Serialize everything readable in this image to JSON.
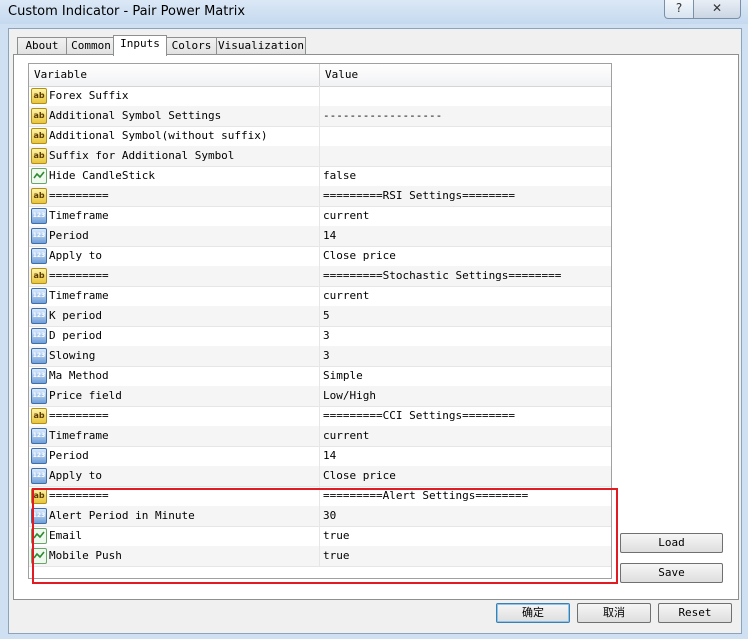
{
  "window": {
    "title": "Custom Indicator - Pair Power Matrix",
    "help_label": "?",
    "close_label": "✕"
  },
  "tabs": [
    {
      "label": "About"
    },
    {
      "label": "Common"
    },
    {
      "label": "Inputs"
    },
    {
      "label": "Colors"
    },
    {
      "label": "Visualization"
    }
  ],
  "active_tab": "Inputs",
  "grid": {
    "columns": [
      "Variable",
      "Value"
    ],
    "rows": [
      {
        "type": "ab",
        "variable": "Forex Suffix",
        "value": ""
      },
      {
        "type": "ab",
        "variable": "Additional Symbol Settings",
        "value": "------------------"
      },
      {
        "type": "ab",
        "variable": "Additional Symbol(without suffix)",
        "value": ""
      },
      {
        "type": "ab",
        "variable": "Suffix for Additional Symbol",
        "value": ""
      },
      {
        "type": "bool",
        "variable": "Hide CandleStick",
        "value": "false"
      },
      {
        "type": "ab",
        "variable": "=========",
        "value": "=========RSI Settings========"
      },
      {
        "type": "num",
        "variable": "Timeframe",
        "value": "current"
      },
      {
        "type": "num",
        "variable": "Period",
        "value": "14"
      },
      {
        "type": "num",
        "variable": "Apply to",
        "value": "Close price"
      },
      {
        "type": "ab",
        "variable": "=========",
        "value": "=========Stochastic Settings========"
      },
      {
        "type": "num",
        "variable": "Timeframe",
        "value": "current"
      },
      {
        "type": "num",
        "variable": "K period",
        "value": "5"
      },
      {
        "type": "num",
        "variable": "D period",
        "value": "3"
      },
      {
        "type": "num",
        "variable": "Slowing",
        "value": "3"
      },
      {
        "type": "num",
        "variable": "Ma Method",
        "value": "Simple"
      },
      {
        "type": "num",
        "variable": "Price field",
        "value": "Low/High"
      },
      {
        "type": "ab",
        "variable": "=========",
        "value": "=========CCI Settings========"
      },
      {
        "type": "num",
        "variable": "Timeframe",
        "value": "current"
      },
      {
        "type": "num",
        "variable": "Period",
        "value": "14"
      },
      {
        "type": "num",
        "variable": "Apply to",
        "value": "Close price"
      },
      {
        "type": "ab",
        "variable": "=========",
        "value": "=========Alert Settings========"
      },
      {
        "type": "num",
        "variable": "Alert Period in Minute",
        "value": "30"
      },
      {
        "type": "bool",
        "variable": "Email",
        "value": "true"
      },
      {
        "type": "bool",
        "variable": "Mobile Push",
        "value": "true"
      }
    ]
  },
  "icons": {
    "ab": "ab",
    "num": "123"
  },
  "highlight_color": "#e21b23",
  "buttons": {
    "load": "Load",
    "save": "Save",
    "ok": "确定",
    "cancel": "取消",
    "reset": "Reset"
  }
}
